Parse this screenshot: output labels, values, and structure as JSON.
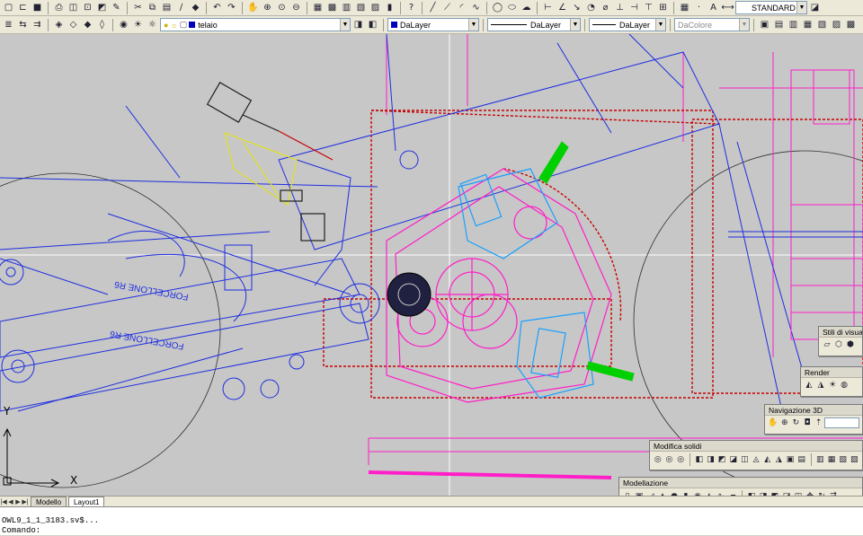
{
  "toolbar_row1": {
    "icons": [
      "new-icon",
      "open-icon",
      "save-icon",
      "plot-icon",
      "preview-icon",
      "publish-icon",
      "sheetset-icon",
      "cut-icon",
      "copy-icon",
      "paste-icon",
      "matchprop-icon",
      "brush-icon",
      "undo-icon",
      "redo-icon",
      "pan-icon",
      "zoom-realtime-icon",
      "zoom-window-icon",
      "zoom-previous-icon",
      "properties-icon",
      "designcenter-icon",
      "toolpalette-icon",
      "sheetset-manager-icon",
      "markup-icon",
      "calculator-icon",
      "help-icon",
      "line-icon",
      "polyline-icon",
      "arc-icon",
      "circle-icon",
      "rectangle-icon",
      "dimension-icon",
      "text-icon",
      "hatch-icon",
      "block-icon",
      "table-icon",
      "text-style-icon",
      "dim-style-icon"
    ],
    "text_style_value": "STANDARD"
  },
  "toolbar_row2": {
    "layer_value": "telaio",
    "color_value": "DaLayer",
    "linetype_value": "DaLayer",
    "lineweight_value": "DaLayer",
    "plotstyle_value": "DaColore"
  },
  "colors": {
    "canvas": "#c7c7c7",
    "blue": "#1e2ee0",
    "magenta": "#ff1ec8",
    "red": "#c80000",
    "cyan": "#18a0ff",
    "yellow": "#e6e600",
    "green": "#00d000",
    "black": "#202020"
  },
  "drawing_labels": {
    "forcellone_upper": "FORCELLONE R6",
    "forcellone_lower": "FORCELLONE R6"
  },
  "ucs": {
    "y_axis": "Y",
    "x_axis": "X"
  },
  "layout_tabs": [
    {
      "label": "Modello",
      "active": false
    },
    {
      "label": "Layout1",
      "active": true
    }
  ],
  "command_line": {
    "line1": "OWL9_1_1_3183.sv$...",
    "line2": "Comando:"
  },
  "palettes": {
    "visual_styles": {
      "title": "Stili di visual"
    },
    "render": {
      "title": "Render"
    },
    "navigation_3d": {
      "title": "Navigazione 3D"
    },
    "solid_editing": {
      "title": "Modifica solidi"
    },
    "modeling": {
      "title": "Modellazione"
    }
  }
}
